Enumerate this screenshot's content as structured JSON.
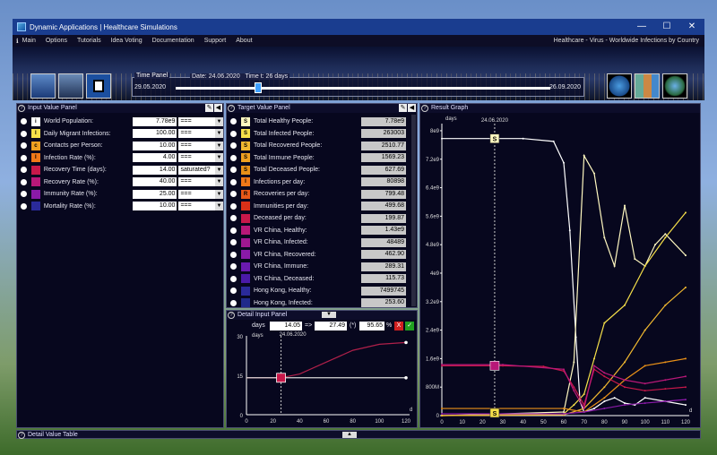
{
  "window": {
    "title": "Dynamic Applications | Healthcare Simulations",
    "minimize": "—",
    "maximize": "☐",
    "close": "✕"
  },
  "menu": {
    "items": [
      "Main",
      "Options",
      "Tutorials",
      "Idea Voting",
      "Documentation",
      "Support",
      "About"
    ],
    "context": "Healthcare - Virus - Worldwide Infections by Country"
  },
  "time_panel": {
    "title": "Time Panel",
    "date_label": "Date:",
    "date_value": "24.06.2020",
    "time_label": "Time t:",
    "time_value": "26",
    "time_unit": "days",
    "start": "29.05.2020",
    "end": "26.09.2020",
    "progress": 0.22
  },
  "input_panel": {
    "title": "Input Value Panel",
    "rows": [
      {
        "sym": "i",
        "color": "#ffffff",
        "label": "World Population:",
        "value": "7.78e9",
        "mode": "==="
      },
      {
        "sym": "I",
        "color": "#f6e04a",
        "label": "Daily Migrant Infections:",
        "value": "100.00",
        "mode": "==="
      },
      {
        "sym": "c",
        "color": "#f0a020",
        "label": "Contacts per Person:",
        "value": "10.00",
        "mode": "==="
      },
      {
        "sym": "I",
        "color": "#f07818",
        "label": "Infection Rate (%):",
        "value": "4.00",
        "mode": "==="
      },
      {
        "sym": "",
        "color": "#c8184a",
        "label": "Recovery Time (days):",
        "value": "14.00",
        "mode": "saturated?"
      },
      {
        "sym": "",
        "color": "#b81878",
        "label": "Recovery Rate (%):",
        "value": "40.00",
        "mode": "==="
      },
      {
        "sym": "",
        "color": "#8a1aa8",
        "label": "Immunity Rate (%):",
        "value": "25.00",
        "mode": "==="
      },
      {
        "sym": "",
        "color": "#2a2a9a",
        "label": "Mortality Rate (%):",
        "value": "10.00",
        "mode": "==="
      }
    ]
  },
  "target_panel": {
    "title": "Target Value Panel",
    "rows": [
      {
        "sym": "S",
        "color": "#fff8c0",
        "label": "Total Healthy People:",
        "value": "7.78e9"
      },
      {
        "sym": "S",
        "color": "#f6e04a",
        "label": "Total Infected People:",
        "value": "263003"
      },
      {
        "sym": "S",
        "color": "#f0b830",
        "label": "Total Recovered People:",
        "value": "2510.77"
      },
      {
        "sym": "S",
        "color": "#f0a020",
        "label": "Total Immune People:",
        "value": "1569.23"
      },
      {
        "sym": "S",
        "color": "#e89018",
        "label": "Total Deceased People:",
        "value": "627.69"
      },
      {
        "sym": "I",
        "color": "#f07818",
        "label": "Infections per day:",
        "value": "80898"
      },
      {
        "sym": "R",
        "color": "#e85818",
        "label": "Recoveries per day:",
        "value": "799.48"
      },
      {
        "sym": "",
        "color": "#d83018",
        "label": "Immunities per day:",
        "value": "499.68"
      },
      {
        "sym": "",
        "color": "#c8184a",
        "label": "Deceased per day:",
        "value": "199.87"
      },
      {
        "sym": "",
        "color": "#b81878",
        "label": "VR China, Healthy:",
        "value": "1.43e9"
      },
      {
        "sym": "",
        "color": "#a01890",
        "label": "VR China, Infected:",
        "value": "48489"
      },
      {
        "sym": "",
        "color": "#8a1aa8",
        "label": "VR China, Recovered:",
        "value": "462.90"
      },
      {
        "sym": "",
        "color": "#6a1ab0",
        "label": "VR China, Immune:",
        "value": "289.31"
      },
      {
        "sym": "",
        "color": "#4a1aa8",
        "label": "VR China, Deceased:",
        "value": "115.73"
      },
      {
        "sym": "",
        "color": "#2a2a9a",
        "label": "Hong Kong, Healthy:",
        "value": "7499745"
      },
      {
        "sym": "",
        "color": "#202a8a",
        "label": "Hong Kong, Infected:",
        "value": "253.60"
      }
    ]
  },
  "detail_input": {
    "title": "Detail Input Panel",
    "unit": "days",
    "from": "14.05",
    "arrow": "=>",
    "to": "27.49",
    "asterisk": "(*)",
    "pct": "95.65",
    "pct_sign": "%",
    "cancel": "X",
    "ok": "✓",
    "chart_date": "24.06.2020",
    "y_ticks": [
      "30",
      "15",
      "0"
    ],
    "x_ticks": [
      "0",
      "20",
      "40",
      "60",
      "80",
      "100",
      "120"
    ],
    "x_unit": "d"
  },
  "result_graph": {
    "title": "Result Graph",
    "y_unit": "days",
    "date": "24.06.2020",
    "y_ticks": [
      "8e9",
      "7.2e9",
      "6.4e9",
      "5.6e9",
      "4.8e9",
      "4e9",
      "3.2e9",
      "2.4e9",
      "1.6e9",
      "800M",
      "0"
    ],
    "x_ticks": [
      "0",
      "10",
      "20",
      "30",
      "40",
      "50",
      "60",
      "70",
      "80",
      "90",
      "100",
      "110",
      "120"
    ],
    "x_unit": "d",
    "marker_label": "S"
  },
  "detail_table": {
    "title": "Detail Value Table"
  },
  "chart_data": [
    {
      "type": "line",
      "title": "",
      "xlabel": "d",
      "ylabel": "days",
      "xlim": [
        0,
        120
      ],
      "ylim": [
        0,
        30
      ],
      "series": [
        {
          "x": [
            0,
            26,
            40,
            60,
            80,
            100,
            120
          ],
          "y": [
            14.05,
            14.05,
            15.5,
            20,
            24.5,
            26.8,
            27.49
          ]
        },
        {
          "x": [
            0,
            120
          ],
          "y": [
            14.05,
            14.05
          ]
        }
      ]
    },
    {
      "type": "line",
      "title": "",
      "xlabel": "d",
      "ylabel": "days",
      "xlim": [
        0,
        120
      ],
      "ylim": [
        0,
        8200000000.0
      ],
      "series": [
        {
          "color": "#ffffff",
          "x": [
            0,
            40,
            55,
            60,
            63,
            66,
            68,
            70,
            75,
            80,
            85,
            90,
            95,
            100,
            110,
            120
          ],
          "y": [
            7780000000.0,
            7780000000.0,
            7700000000.0,
            7100000000.0,
            5200000000.0,
            2200000000.0,
            400000000.0,
            100000000.0,
            200000000.0,
            400000000.0,
            500000000.0,
            350000000.0,
            300000000.0,
            500000000.0,
            400000000.0,
            300000000.0
          ]
        },
        {
          "color": "#fff8c0",
          "x": [
            0,
            60,
            65,
            70,
            75,
            80,
            85,
            90,
            95,
            100,
            105,
            110,
            120
          ],
          "y": [
            0,
            100000000.0,
            1500000000.0,
            7300000000.0,
            6800000000.0,
            5000000000.0,
            4200000000.0,
            5900000000.0,
            4400000000.0,
            4200000000.0,
            4800000000.0,
            5100000000.0,
            4500000000.0
          ]
        },
        {
          "color": "#f6e04a",
          "x": [
            0,
            60,
            65,
            70,
            75,
            80,
            90,
            100,
            110,
            120
          ],
          "y": [
            0,
            50000000.0,
            300000000.0,
            600000000.0,
            1600000000.0,
            2600000000.0,
            3100000000.0,
            4200000000.0,
            5000000000.0,
            5700000000.0
          ]
        },
        {
          "color": "#f0b830",
          "x": [
            0,
            60,
            70,
            80,
            90,
            100,
            110,
            120
          ],
          "y": [
            0,
            20000000.0,
            200000000.0,
            800000000.0,
            1500000000.0,
            2400000000.0,
            3100000000.0,
            3600000000.0
          ]
        },
        {
          "color": "#e89018",
          "x": [
            0,
            60,
            70,
            80,
            90,
            100,
            110,
            120
          ],
          "y": [
            200000000.0,
            200000000.0,
            100000000.0,
            500000000.0,
            1000000000.0,
            1400000000.0,
            1500000000.0,
            1600000000.0
          ]
        },
        {
          "color": "#c8184a",
          "x": [
            0,
            30,
            50,
            60,
            65,
            70,
            75,
            80,
            90,
            100,
            110,
            120
          ],
          "y": [
            1400000000.0,
            1400000000.0,
            1380000000.0,
            1250000000.0,
            800000000.0,
            300000000.0,
            1300000000.0,
            1100000000.0,
            800000000.0,
            700000000.0,
            750000000.0,
            800000000.0
          ]
        },
        {
          "color": "#b81878",
          "x": [
            0,
            30,
            60,
            65,
            70,
            75,
            80,
            90,
            100,
            110,
            120
          ],
          "y": [
            1430000000.0,
            1430000000.0,
            1300000000.0,
            700000000.0,
            200000000.0,
            1400000000.0,
            1200000000.0,
            1000000000.0,
            900000000.0,
            1000000000.0,
            1100000000.0
          ]
        },
        {
          "color": "#8a1aa8",
          "x": [
            0,
            60,
            70,
            80,
            90,
            100,
            110,
            120
          ],
          "y": [
            50000000.0,
            50000000.0,
            100000000.0,
            200000000.0,
            300000000.0,
            350000000.0,
            400000000.0,
            450000000.0
          ]
        }
      ]
    }
  ]
}
